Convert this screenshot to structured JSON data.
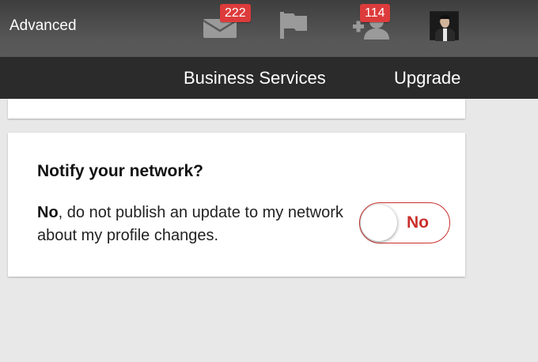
{
  "header": {
    "advanced_label": "Advanced",
    "messages_count": "222",
    "invitations_count": "114"
  },
  "subnav": {
    "business_services": "Business Services",
    "upgrade": "Upgrade"
  },
  "notify": {
    "title": "Notify your network?",
    "text_bold": "No",
    "text_rest": ", do not publish an update to my network about my profile changes.",
    "toggle_label": "No",
    "toggle_on": false
  },
  "colors": {
    "badge": "#dd3b3b",
    "toggle_accent": "#c9302c",
    "header_bg": "#4d4d4d",
    "subnav_bg": "#2b2b2b",
    "page_bg": "#e8e8e8"
  },
  "icons": [
    "envelope-icon",
    "flag-icon",
    "add-connection-icon",
    "avatar"
  ]
}
